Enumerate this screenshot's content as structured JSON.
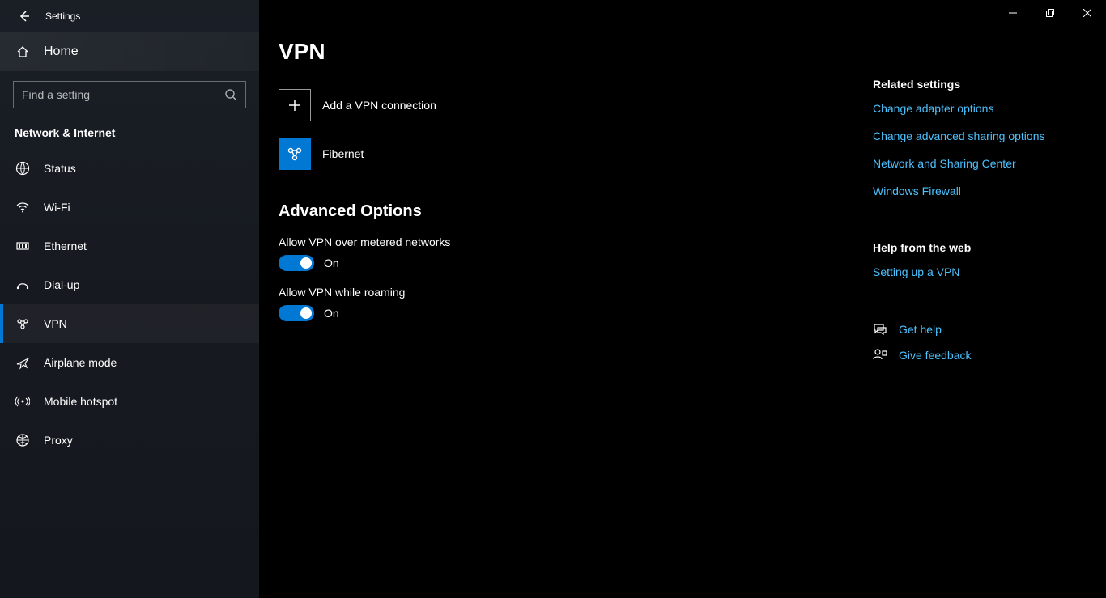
{
  "window": {
    "title": "Settings"
  },
  "sidebar": {
    "home": "Home",
    "search_placeholder": "Find a setting",
    "section": "Network & Internet",
    "items": [
      {
        "label": "Status"
      },
      {
        "label": "Wi-Fi"
      },
      {
        "label": "Ethernet"
      },
      {
        "label": "Dial-up"
      },
      {
        "label": "VPN"
      },
      {
        "label": "Airplane mode"
      },
      {
        "label": "Mobile hotspot"
      },
      {
        "label": "Proxy"
      }
    ]
  },
  "main": {
    "title": "VPN",
    "add_label": "Add a VPN connection",
    "connections": [
      {
        "name": "Fibernet"
      }
    ],
    "advanced": {
      "heading": "Advanced Options",
      "opt1_label": "Allow VPN over metered networks",
      "opt1_state": "On",
      "opt2_label": "Allow VPN while roaming",
      "opt2_state": "On"
    }
  },
  "right": {
    "related_heading": "Related settings",
    "links": {
      "adapter": "Change adapter options",
      "sharing": "Change advanced sharing options",
      "center": "Network and Sharing Center",
      "firewall": "Windows Firewall"
    },
    "help_heading": "Help from the web",
    "help_link": "Setting up a VPN",
    "get_help": "Get help",
    "feedback": "Give feedback"
  }
}
